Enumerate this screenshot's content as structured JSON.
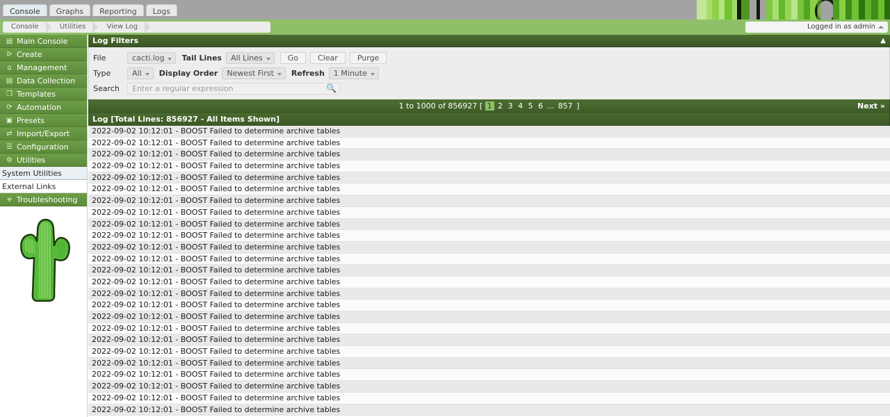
{
  "app": {
    "accent_green": "#8fc069",
    "header_green": "#4a6b2f",
    "nav_green": "#6d9e47",
    "topbar_gray": "#a3a3a3"
  },
  "tabs": [
    {
      "label": "Console",
      "active": true
    },
    {
      "label": "Graphs",
      "active": false
    },
    {
      "label": "Reporting",
      "active": false
    },
    {
      "label": "Logs",
      "active": false
    }
  ],
  "breadcrumb": [
    "Console",
    "Utilities",
    "View Log"
  ],
  "user": {
    "status_text": "Logged in as admin",
    "caret_icon": "caret-up-icon"
  },
  "sidebar": {
    "items": [
      {
        "label": "Main Console",
        "icon": "book-icon",
        "glyph": "▤",
        "type": "nav"
      },
      {
        "label": "Create",
        "icon": "chart-icon",
        "glyph": "ᐅ",
        "type": "nav"
      },
      {
        "label": "Management",
        "icon": "home-icon",
        "glyph": "⌂",
        "type": "nav"
      },
      {
        "label": "Data Collection",
        "icon": "database-icon",
        "glyph": "▤",
        "type": "nav"
      },
      {
        "label": "Templates",
        "icon": "copy-icon",
        "glyph": "❐",
        "type": "nav"
      },
      {
        "label": "Automation",
        "icon": "refresh-icon",
        "glyph": "⟳",
        "type": "nav"
      },
      {
        "label": "Presets",
        "icon": "window-icon",
        "glyph": "▣",
        "type": "nav"
      },
      {
        "label": "Import/Export",
        "icon": "exchange-icon",
        "glyph": "⇄",
        "type": "nav"
      },
      {
        "label": "Configuration",
        "icon": "sliders-icon",
        "glyph": "☰",
        "type": "nav"
      },
      {
        "label": "Utilities",
        "icon": "gears-icon",
        "glyph": "⚙",
        "type": "nav"
      },
      {
        "label": "System Utilities",
        "icon": "",
        "glyph": "",
        "type": "sub",
        "selected": true
      },
      {
        "label": "External Links",
        "icon": "",
        "glyph": "",
        "type": "sub",
        "selected": false
      },
      {
        "label": "Troubleshooting",
        "icon": "bug-icon",
        "glyph": "☣",
        "type": "nav"
      }
    ],
    "mascot_icon": "cactus-logo"
  },
  "filters": {
    "panel_title": "Log Filters",
    "collapse_icon": "chevron-up-icon",
    "file_label": "File",
    "file_value": "cacti.log",
    "tail_lines_label": "Tail Lines",
    "tail_lines_value": "All Lines",
    "go_label": "Go",
    "clear_label": "Clear",
    "purge_label": "Purge",
    "type_label": "Type",
    "type_value": "All",
    "display_order_label": "Display Order",
    "display_order_value": "Newest First",
    "refresh_label": "Refresh",
    "refresh_value": "1 Minute",
    "search_label": "Search",
    "search_value": "",
    "search_placeholder": "Enter a regular expression",
    "search_icon": "magnifier-icon"
  },
  "pagination": {
    "summary": "1 to 1000 of 856927 [",
    "bracket_close": "]",
    "pages": [
      "1",
      "2",
      "3",
      "4",
      "5",
      "6",
      "...",
      "857"
    ],
    "current_page": "1",
    "next_label": "Next »"
  },
  "log": {
    "header": "Log [Total Lines: 856927 - All Items Shown]",
    "total_lines": "856927",
    "entry_text": "2022-09-02 10:12:01 - BOOST Failed to determine archive tables",
    "visible_row_count": 25,
    "rows": [
      "2022-09-02 10:12:01 - BOOST Failed to determine archive tables",
      "2022-09-02 10:12:01 - BOOST Failed to determine archive tables",
      "2022-09-02 10:12:01 - BOOST Failed to determine archive tables",
      "2022-09-02 10:12:01 - BOOST Failed to determine archive tables",
      "2022-09-02 10:12:01 - BOOST Failed to determine archive tables",
      "2022-09-02 10:12:01 - BOOST Failed to determine archive tables",
      "2022-09-02 10:12:01 - BOOST Failed to determine archive tables",
      "2022-09-02 10:12:01 - BOOST Failed to determine archive tables",
      "2022-09-02 10:12:01 - BOOST Failed to determine archive tables",
      "2022-09-02 10:12:01 - BOOST Failed to determine archive tables",
      "2022-09-02 10:12:01 - BOOST Failed to determine archive tables",
      "2022-09-02 10:12:01 - BOOST Failed to determine archive tables",
      "2022-09-02 10:12:01 - BOOST Failed to determine archive tables",
      "2022-09-02 10:12:01 - BOOST Failed to determine archive tables",
      "2022-09-02 10:12:01 - BOOST Failed to determine archive tables",
      "2022-09-02 10:12:01 - BOOST Failed to determine archive tables",
      "2022-09-02 10:12:01 - BOOST Failed to determine archive tables",
      "2022-09-02 10:12:01 - BOOST Failed to determine archive tables",
      "2022-09-02 10:12:01 - BOOST Failed to determine archive tables",
      "2022-09-02 10:12:01 - BOOST Failed to determine archive tables",
      "2022-09-02 10:12:01 - BOOST Failed to determine archive tables",
      "2022-09-02 10:12:01 - BOOST Failed to determine archive tables",
      "2022-09-02 10:12:01 - BOOST Failed to determine archive tables",
      "2022-09-02 10:12:01 - BOOST Failed to determine archive tables",
      "2022-09-02 10:12:01 - BOOST Failed to determine archive tables"
    ]
  }
}
